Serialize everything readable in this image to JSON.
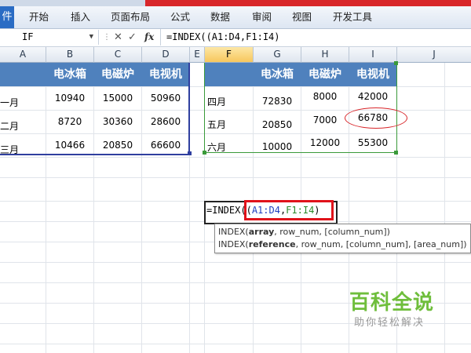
{
  "ribbon": {
    "file_tab": "件",
    "tabs": [
      "开始",
      "插入",
      "页面布局",
      "公式",
      "数据",
      "审阅",
      "视图",
      "开发工具"
    ]
  },
  "formula_bar": {
    "name_box": "IF",
    "fx": "fx",
    "formula": "=INDEX((A1:D4,F1:I4)"
  },
  "columns": [
    "A",
    "B",
    "C",
    "D",
    "E",
    "F",
    "G",
    "H",
    "I",
    "J"
  ],
  "table1": {
    "headers": [
      "电冰箱",
      "电磁炉",
      "电视机"
    ],
    "rows": [
      {
        "label": "一月",
        "values": [
          "10940",
          "15000",
          "50960"
        ]
      },
      {
        "label": "二月",
        "values": [
          "8720",
          "30360",
          "28600"
        ]
      },
      {
        "label": "三月",
        "values": [
          "10466",
          "20850",
          "66600"
        ]
      }
    ]
  },
  "table2": {
    "headers": [
      "电冰箱",
      "电磁炉",
      "电视机"
    ],
    "rows": [
      {
        "label": "四月",
        "values": [
          "72830",
          "8000",
          "42000"
        ]
      },
      {
        "label": "五月",
        "values": [
          "20850",
          "7000",
          "66780"
        ]
      },
      {
        "label": "六月",
        "values": [
          "10000",
          "12000",
          "55300"
        ]
      }
    ]
  },
  "edit_cell": {
    "prefix": "=INDEX(",
    "paren": "(",
    "ref1": "A1:D4",
    "comma": ",",
    "ref2": "F1:I4",
    "close": ")"
  },
  "tooltip": {
    "line1": {
      "fn": "INDEX(",
      "arg": "array",
      "rest": ", row_num, [column_num])"
    },
    "line2": {
      "fn": "INDEX(",
      "arg": "reference",
      "rest": ", row_num, [column_num], [area_num])"
    }
  },
  "watermark": {
    "title": "百科全说",
    "subtitle": "助你轻松解决"
  },
  "colors": {
    "header_blue": "#4f81bd",
    "highlight_red": "#e0121a",
    "watermark_green": "#6fbe3c"
  }
}
